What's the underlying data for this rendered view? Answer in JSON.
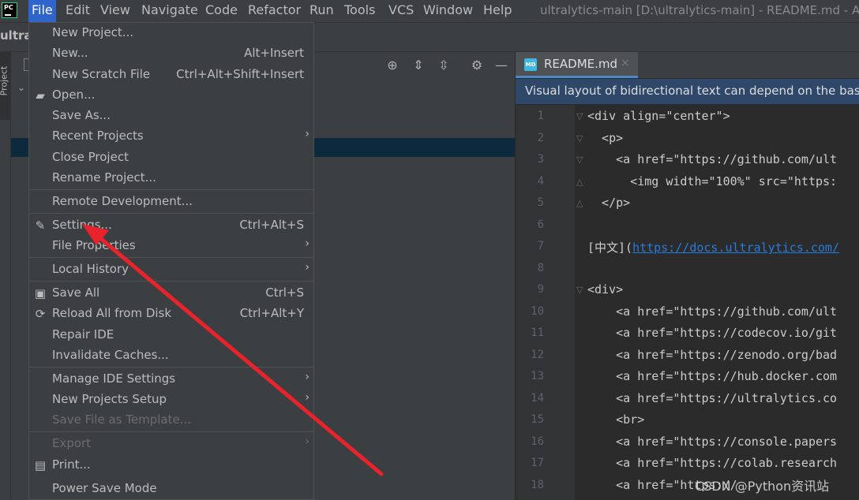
{
  "menubar": {
    "items": [
      "File",
      "Edit",
      "View",
      "Navigate",
      "Code",
      "Refactor",
      "Run",
      "Tools",
      "VCS",
      "Window",
      "Help"
    ],
    "window_title": "ultralytics-main [D:\\ultralytics-main] - README.md - Adm"
  },
  "navbar": {
    "project_name": "ultra"
  },
  "left_strip": {
    "project_tab": "Project"
  },
  "editor": {
    "tab_name": "README.md",
    "tab_icon": "MD",
    "banner": "Visual layout of bidirectional text can depend on the base",
    "lines": [
      {
        "n": "1",
        "code": "<div align=\"center\">"
      },
      {
        "n": "2",
        "code": "  <p>"
      },
      {
        "n": "3",
        "code": "    <a href=\"https://github.com/ult"
      },
      {
        "n": "4",
        "code": "      <img width=\"100%\" src=\"https:"
      },
      {
        "n": "5",
        "code": "  </p>"
      },
      {
        "n": "6",
        "code": ""
      },
      {
        "n": "7",
        "code": "[中文](",
        "link": "https://docs.ultralytics.com/"
      },
      {
        "n": "8",
        "code": ""
      },
      {
        "n": "9",
        "code": "<div>"
      },
      {
        "n": "10",
        "code": "    <a href=\"https://github.com/ult"
      },
      {
        "n": "11",
        "code": "    <a href=\"https://codecov.io/git"
      },
      {
        "n": "12",
        "code": "    <a href=\"https://zenodo.org/bad"
      },
      {
        "n": "13",
        "code": "    <a href=\"https://hub.docker.com"
      },
      {
        "n": "14",
        "code": "    <a href=\"https://ultralytics.co"
      },
      {
        "n": "15",
        "code": "    <br>"
      },
      {
        "n": "16",
        "code": "    <a href=\"https://console.papers"
      },
      {
        "n": "17",
        "code": "    <a href=\"https://colab.research"
      },
      {
        "n": "18",
        "code": "    <a href=\"https://"
      }
    ],
    "watermark": "CSDN @Python资讯站"
  },
  "file_menu": {
    "items": [
      {
        "label": "New Project...",
        "shortcut": "",
        "icon": "",
        "arrow": false,
        "disabled": false
      },
      {
        "label": "New...",
        "shortcut": "Alt+Insert",
        "icon": "",
        "arrow": false,
        "disabled": false
      },
      {
        "label": "New Scratch File",
        "shortcut": "Ctrl+Alt+Shift+Insert",
        "icon": "",
        "arrow": false,
        "disabled": false
      },
      {
        "label": "Open...",
        "shortcut": "",
        "icon": "folder-icon",
        "arrow": false,
        "disabled": false
      },
      {
        "label": "Save As...",
        "shortcut": "",
        "icon": "",
        "arrow": false,
        "disabled": false
      },
      {
        "label": "Recent Projects",
        "shortcut": "",
        "icon": "",
        "arrow": true,
        "disabled": false
      },
      {
        "label": "Close Project",
        "shortcut": "",
        "icon": "",
        "arrow": false,
        "disabled": false
      },
      {
        "label": "Rename Project...",
        "shortcut": "",
        "icon": "",
        "arrow": false,
        "disabled": false
      },
      {
        "label": "Remote Development...",
        "shortcut": "",
        "icon": "",
        "arrow": false,
        "disabled": false
      },
      {
        "label": "Settings...",
        "shortcut": "Ctrl+Alt+S",
        "icon": "wrench-icon",
        "arrow": false,
        "disabled": false
      },
      {
        "label": "File Properties",
        "shortcut": "",
        "icon": "",
        "arrow": true,
        "disabled": false
      },
      {
        "label": "Local History",
        "shortcut": "",
        "icon": "",
        "arrow": true,
        "disabled": false
      },
      {
        "label": "Save All",
        "shortcut": "Ctrl+S",
        "icon": "save-icon",
        "arrow": false,
        "disabled": false
      },
      {
        "label": "Reload All from Disk",
        "shortcut": "Ctrl+Alt+Y",
        "icon": "reload-icon",
        "arrow": false,
        "disabled": false
      },
      {
        "label": "Repair IDE",
        "shortcut": "",
        "icon": "",
        "arrow": false,
        "disabled": false
      },
      {
        "label": "Invalidate Caches...",
        "shortcut": "",
        "icon": "",
        "arrow": false,
        "disabled": false
      },
      {
        "label": "Manage IDE Settings",
        "shortcut": "",
        "icon": "",
        "arrow": true,
        "disabled": false
      },
      {
        "label": "New Projects Setup",
        "shortcut": "",
        "icon": "",
        "arrow": true,
        "disabled": false
      },
      {
        "label": "Save File as Template...",
        "shortcut": "",
        "icon": "",
        "arrow": false,
        "disabled": true
      },
      {
        "label": "Export",
        "shortcut": "",
        "icon": "",
        "arrow": true,
        "disabled": true
      },
      {
        "label": "Print...",
        "shortcut": "",
        "icon": "print-icon",
        "arrow": false,
        "disabled": false
      },
      {
        "label": "Power Save Mode",
        "shortcut": "",
        "icon": "",
        "arrow": false,
        "disabled": false
      }
    ]
  },
  "colors": {
    "menu_bg": "#3c3f41",
    "active_menu": "#2f65ca",
    "banner_bg": "#2f4869",
    "annotation_arrow": "#e8232b"
  }
}
